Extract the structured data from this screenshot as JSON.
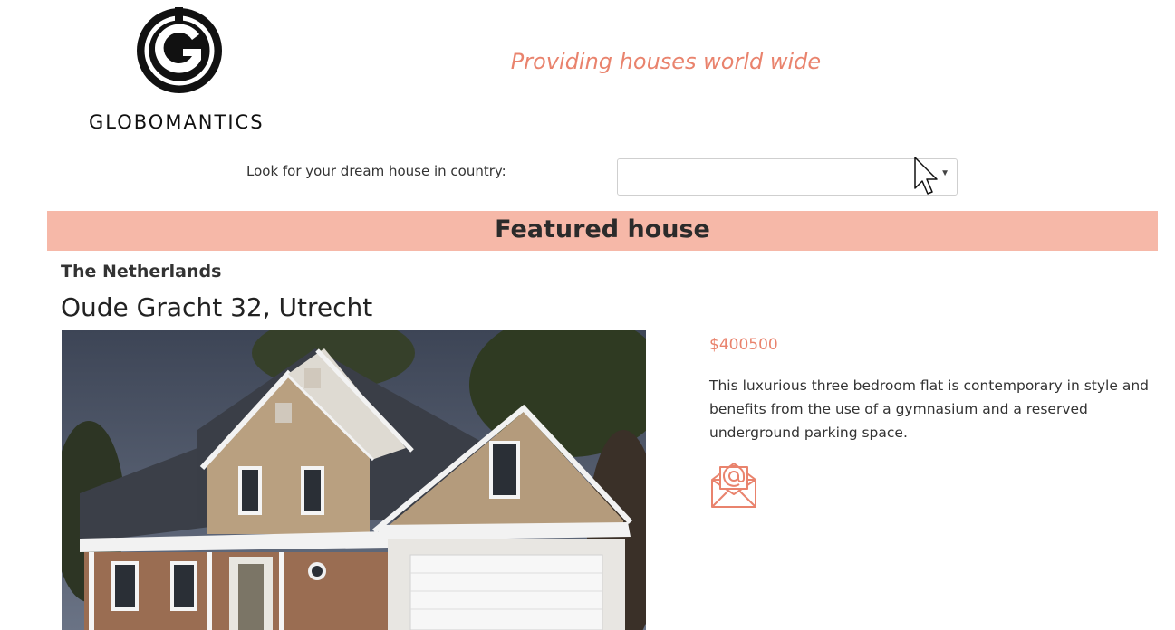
{
  "header": {
    "logo_text": "GLOBOMANTICS",
    "tagline": "Providing houses world wide"
  },
  "search": {
    "label": "Look for your dream house in country:",
    "selected_value": ""
  },
  "featured": {
    "heading": "Featured house",
    "country": "The Netherlands",
    "address": "Oude Gracht 32, Utrecht",
    "price": "$400500",
    "description": "This luxurious three bedroom flat is contemporary in style and benefits from the use of a gymnasium and a reserved underground parking space.",
    "contact_icon": "email-envelope-icon"
  },
  "colors": {
    "accent": "#e9836d",
    "banner": "#f6b8a8"
  }
}
